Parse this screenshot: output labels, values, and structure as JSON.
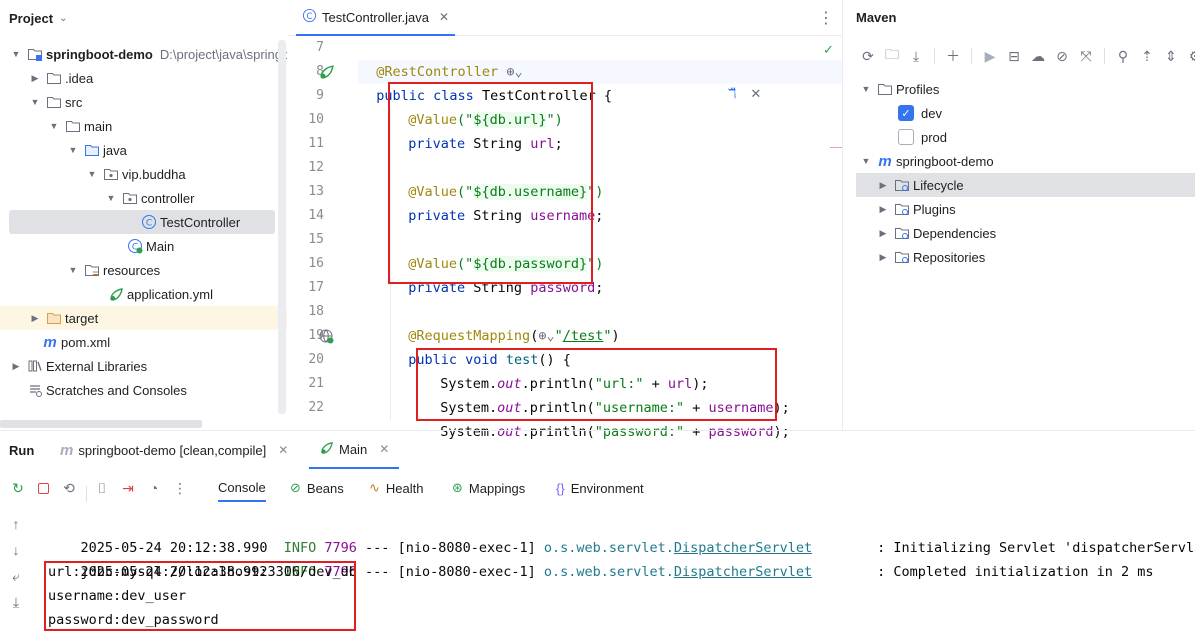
{
  "project": {
    "header": "Project",
    "tree": [
      {
        "label": "springboot-demo",
        "sub": "D:\\project\\java\\springboot-demo",
        "icon": "module-folder-icon"
      },
      {
        "label": ".idea",
        "icon": "folder-icon"
      },
      {
        "label": "src",
        "icon": "folder-icon"
      },
      {
        "label": "main",
        "icon": "folder-icon"
      },
      {
        "label": "java",
        "icon": "source-folder-icon"
      },
      {
        "label": "vip.buddha",
        "icon": "package-icon"
      },
      {
        "label": "controller",
        "icon": "package-icon"
      },
      {
        "label": "TestController",
        "icon": "class-icon"
      },
      {
        "label": "Main",
        "icon": "main-class-icon"
      },
      {
        "label": "resources",
        "icon": "resources-folder-icon"
      },
      {
        "label": "application.yml",
        "icon": "yaml-file-icon"
      },
      {
        "label": "target",
        "icon": "excluded-folder-icon"
      },
      {
        "label": "pom.xml",
        "icon": "maven-file-icon"
      },
      {
        "label": "External Libraries",
        "icon": "library-icon"
      },
      {
        "label": "Scratches and Consoles",
        "icon": "scratches-icon"
      }
    ]
  },
  "editor": {
    "tab_label": "TestController.java",
    "line_numbers": [
      "7",
      "8",
      "9",
      "10",
      "11",
      "12",
      "13",
      "14",
      "15",
      "16",
      "17",
      "18",
      "19",
      "20",
      "21",
      "22"
    ],
    "code": {
      "l7_ann": "@RestController",
      "l8_kw": "public class ",
      "l8_name": "TestController",
      "l8_rest": " {",
      "l9_ann": "@Value",
      "l9_open": "(\"",
      "l9_ph": "${db.url}",
      "l9_close": "\")",
      "l10_kw": "private ",
      "l10_type": "String ",
      "l10_field": "url",
      "l10_end": ";",
      "l12_ann": "@Value",
      "l12_open": "(\"",
      "l12_ph": "${db.username}",
      "l12_close": "\")",
      "l13_kw": "private ",
      "l13_type": "String ",
      "l13_field": "username",
      "l13_end": ";",
      "l15_ann": "@Value",
      "l15_open": "(\"",
      "l15_ph": "${db.password}",
      "l15_close": "\")",
      "l16_kw": "private ",
      "l16_type": "String ",
      "l16_field": "password",
      "l16_end": ";",
      "l18_ann": "@RequestMapping",
      "l18_open": "(",
      "l18_q1": "\"",
      "l18_url": "/test",
      "l18_q2": "\"",
      "l18_close": ")",
      "l19_kw": "public void ",
      "l19_name": "test",
      "l19_rest": "() {",
      "l20_a": "System.",
      "l20_out": "out",
      "l20_b": ".println(",
      "l20_s": "\"url:\"",
      "l20_c": " + ",
      "l20_f": "url",
      "l20_d": ");",
      "l21_a": "System.",
      "l21_out": "out",
      "l21_b": ".println(",
      "l21_s": "\"username:\"",
      "l21_c": " + ",
      "l21_f": "username",
      "l21_d": ");",
      "l22_a": "System.",
      "l22_out": "out",
      "l22_b": ".println(",
      "l22_s": "\"password:\"",
      "l22_c": " + ",
      "l22_f": "password",
      "l22_d": ");"
    }
  },
  "maven": {
    "title": "Maven",
    "profiles_label": "Profiles",
    "profiles": [
      {
        "label": "dev",
        "checked": true
      },
      {
        "label": "prod",
        "checked": false
      }
    ],
    "project_label": "springboot-demo",
    "nodes": [
      "Lifecycle",
      "Plugins",
      "Dependencies",
      "Repositories"
    ]
  },
  "run": {
    "title": "Run",
    "tabs": [
      "springboot-demo [clean,compile]",
      "Main"
    ],
    "console_tabs": [
      "Console",
      "Beans",
      "Health",
      "Mappings",
      "Environment"
    ],
    "log_lines": [
      {
        "time": "2025-05-24 20:12:38.990",
        "level": "INFO",
        "pid": "7796",
        "sep": "---",
        "thread": "[nio-8080-exec-1]",
        "logger_prefix": "o.s.web.servlet.",
        "logger_cls": "DispatcherServlet",
        "msg": ": Initializing Servlet 'dispatcherServlet'"
      },
      {
        "time": "2025-05-24 20:12:38.992",
        "level": "INFO",
        "pid": "7796",
        "sep": "---",
        "thread": "[nio-8080-exec-1]",
        "logger_prefix": "o.s.web.servlet.",
        "logger_cls": "DispatcherServlet",
        "msg": ": Completed initialization in 2 ms"
      }
    ],
    "output_lines": [
      "url:jdbc:mysql://localhost:3306/dev_db",
      "username:dev_user",
      "password:dev_password"
    ]
  }
}
